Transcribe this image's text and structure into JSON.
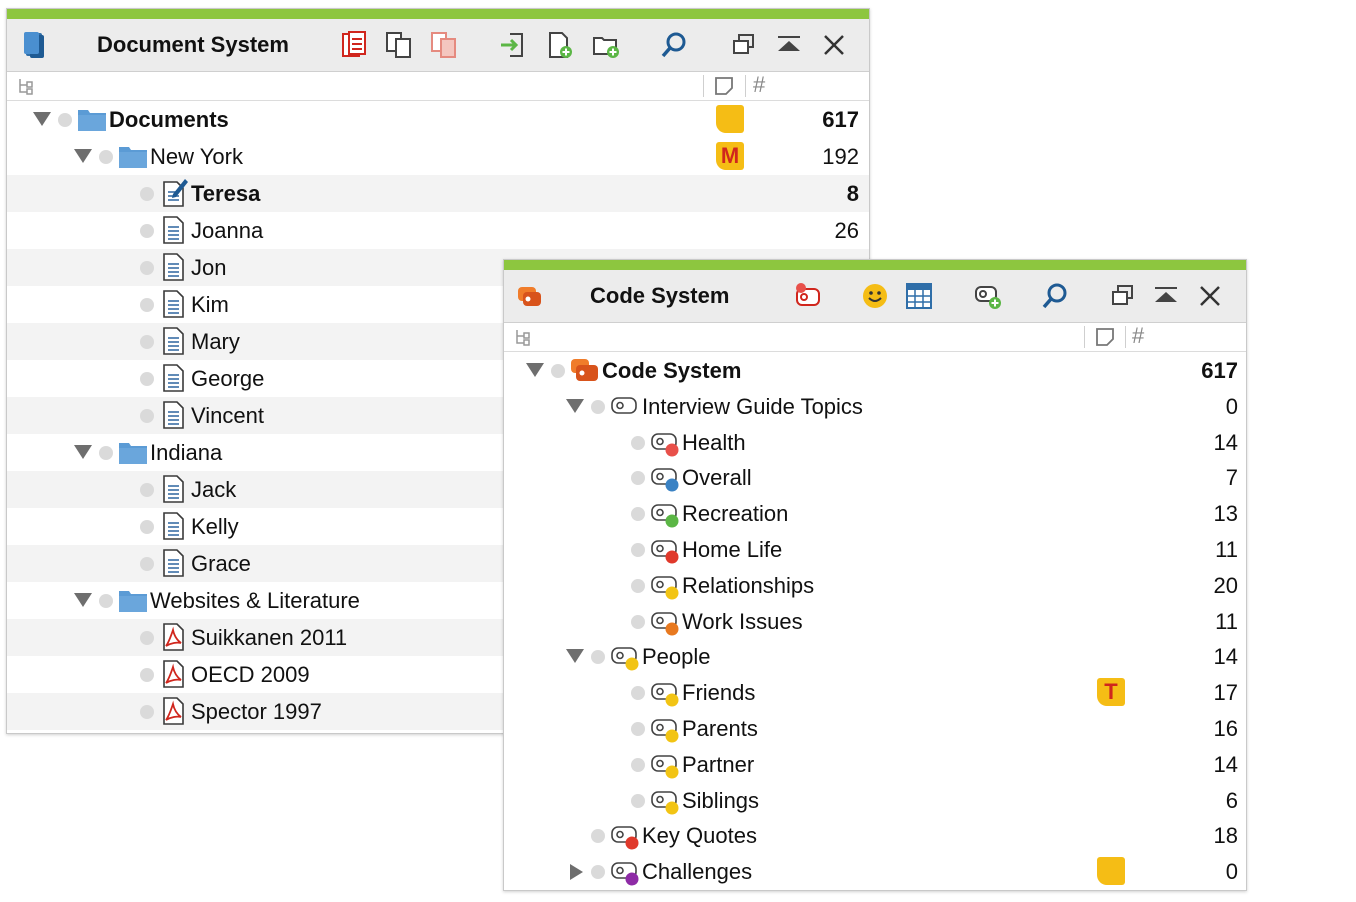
{
  "colors": {
    "accent": "#8dc63f",
    "folder": "#5b9bd5",
    "pdf": "#d0261d",
    "memo": "#f5bd15"
  },
  "document_system": {
    "title": "Document System",
    "toolbar_icons": [
      "retrieve-documents-icon",
      "copy-documents-icon",
      "copy-documents-alt-icon",
      "import-icon",
      "new-document-icon",
      "new-document-group-icon",
      "search-icon",
      "undock-icon",
      "collapse-icon",
      "close-icon"
    ],
    "column_headers": {
      "memo": "memo-column-icon",
      "count": "#"
    },
    "rows": [
      {
        "label": "Documents",
        "count": "617",
        "level": 0,
        "type": "root-folder",
        "expanded": true,
        "bold": true,
        "memo": " "
      },
      {
        "label": "New York",
        "count": "192",
        "level": 1,
        "type": "folder",
        "expanded": true,
        "memo": "M"
      },
      {
        "label": "Teresa",
        "count": "8",
        "level": 2,
        "type": "doc-edit",
        "bold": true
      },
      {
        "label": "Joanna",
        "count": "26",
        "level": 2,
        "type": "doc"
      },
      {
        "label": "Jon",
        "count": "",
        "level": 2,
        "type": "doc"
      },
      {
        "label": "Kim",
        "count": "",
        "level": 2,
        "type": "doc"
      },
      {
        "label": "Mary",
        "count": "",
        "level": 2,
        "type": "doc"
      },
      {
        "label": "George",
        "count": "",
        "level": 2,
        "type": "doc"
      },
      {
        "label": "Vincent",
        "count": "",
        "level": 2,
        "type": "doc"
      },
      {
        "label": "Indiana",
        "count": "",
        "level": 1,
        "type": "folder",
        "expanded": true
      },
      {
        "label": "Jack",
        "count": "",
        "level": 2,
        "type": "doc"
      },
      {
        "label": "Kelly",
        "count": "",
        "level": 2,
        "type": "doc"
      },
      {
        "label": "Grace",
        "count": "",
        "level": 2,
        "type": "doc"
      },
      {
        "label": "Websites & Literature",
        "count": "",
        "level": 1,
        "type": "folder",
        "expanded": true
      },
      {
        "label": "Suikkanen 2011",
        "count": "",
        "level": 2,
        "type": "pdf"
      },
      {
        "label": "OECD 2009",
        "count": "",
        "level": 2,
        "type": "pdf"
      },
      {
        "label": "Spector 1997",
        "count": "",
        "level": 2,
        "type": "pdf"
      }
    ]
  },
  "code_system": {
    "title": "Code System",
    "toolbar_icons": [
      "code-favorites-icon",
      "emoticode-icon",
      "code-matrix-icon",
      "new-code-icon",
      "search-icon",
      "undock-icon",
      "collapse-icon",
      "close-icon"
    ],
    "column_headers": {
      "memo": "memo-column-icon",
      "count": "#"
    },
    "rows": [
      {
        "label": "Code System",
        "count": "617",
        "level": 0,
        "type": "root",
        "expanded": true,
        "bold": true
      },
      {
        "label": "Interview Guide Topics",
        "count": "0",
        "level": 1,
        "type": "code",
        "expanded": true,
        "color": ""
      },
      {
        "label": "Health",
        "count": "14",
        "level": 2,
        "type": "code",
        "color": "#e8504a"
      },
      {
        "label": "Overall",
        "count": "7",
        "level": 2,
        "type": "code",
        "color": "#3a82c4"
      },
      {
        "label": "Recreation",
        "count": "13",
        "level": 2,
        "type": "code",
        "color": "#5bb645"
      },
      {
        "label": "Home Life",
        "count": "11",
        "level": 2,
        "type": "code",
        "color": "#e0392b"
      },
      {
        "label": "Relationships",
        "count": "20",
        "level": 2,
        "type": "code",
        "color": "#f2c414"
      },
      {
        "label": "Work Issues",
        "count": "11",
        "level": 2,
        "type": "code",
        "color": "#e8791f"
      },
      {
        "label": "People",
        "count": "14",
        "level": 1,
        "type": "code",
        "expanded": true,
        "color": "#f2c414"
      },
      {
        "label": "Friends",
        "count": "17",
        "level": 2,
        "type": "code",
        "color": "#f2c414",
        "memo": "T"
      },
      {
        "label": "Parents",
        "count": "16",
        "level": 2,
        "type": "code",
        "color": "#f2c414"
      },
      {
        "label": "Partner",
        "count": "14",
        "level": 2,
        "type": "code",
        "color": "#f2c414"
      },
      {
        "label": "Siblings",
        "count": "6",
        "level": 2,
        "type": "code",
        "color": "#f2c414"
      },
      {
        "label": "Key Quotes",
        "count": "18",
        "level": 1,
        "type": "code",
        "color": "#e0392b"
      },
      {
        "label": "Challenges",
        "count": "0",
        "level": 1,
        "type": "code",
        "collapsed": true,
        "color": "#8e2ba6",
        "memo": " "
      }
    ]
  }
}
